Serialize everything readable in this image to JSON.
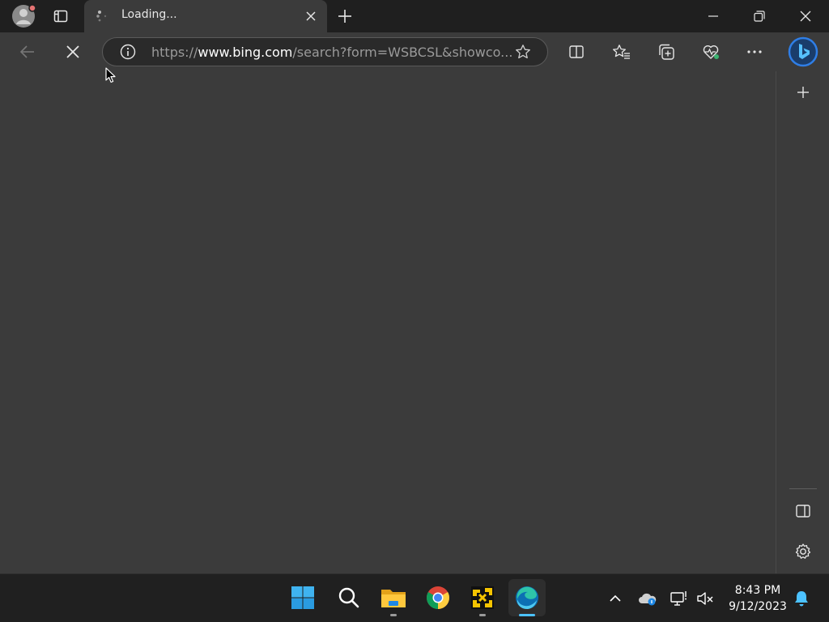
{
  "tab": {
    "title": "Loading...",
    "close_label": "×"
  },
  "address_bar": {
    "url_prefix": "https://",
    "url_host": "www.bing.com",
    "url_rest": "/search?form=WSBCSL&showco..."
  },
  "toolbar_icons": [
    "back-arrow-icon",
    "stop-icon",
    "info-icon",
    "favorite-star-icon",
    "split-screen-icon",
    "favorites-icon",
    "collections-icon",
    "browser-essentials-icon",
    "more-icon",
    "bing-icon"
  ],
  "sidebar_icons": [
    "add-icon",
    "sidebar-panel-icon",
    "gear-icon"
  ],
  "taskbar": {
    "apps": [
      "windows-start-icon",
      "search-icon",
      "file-explorer-icon",
      "chrome-icon",
      "yellow-app-icon",
      "edge-icon"
    ],
    "tray_icons": [
      "chevron-up-icon",
      "cloud-icon",
      "network-icon",
      "speaker-muted-icon"
    ],
    "clock": {
      "time": "8:43 PM",
      "date": "9/12/2023"
    }
  },
  "colors": {
    "title_bar": "#1f1f1f",
    "tab_active": "#3b3b3b",
    "toolbar": "#3b3b3b",
    "taskbar": "#202020",
    "accent": "#4cc2ff",
    "edge_active_bar": "#4cc2ff"
  }
}
